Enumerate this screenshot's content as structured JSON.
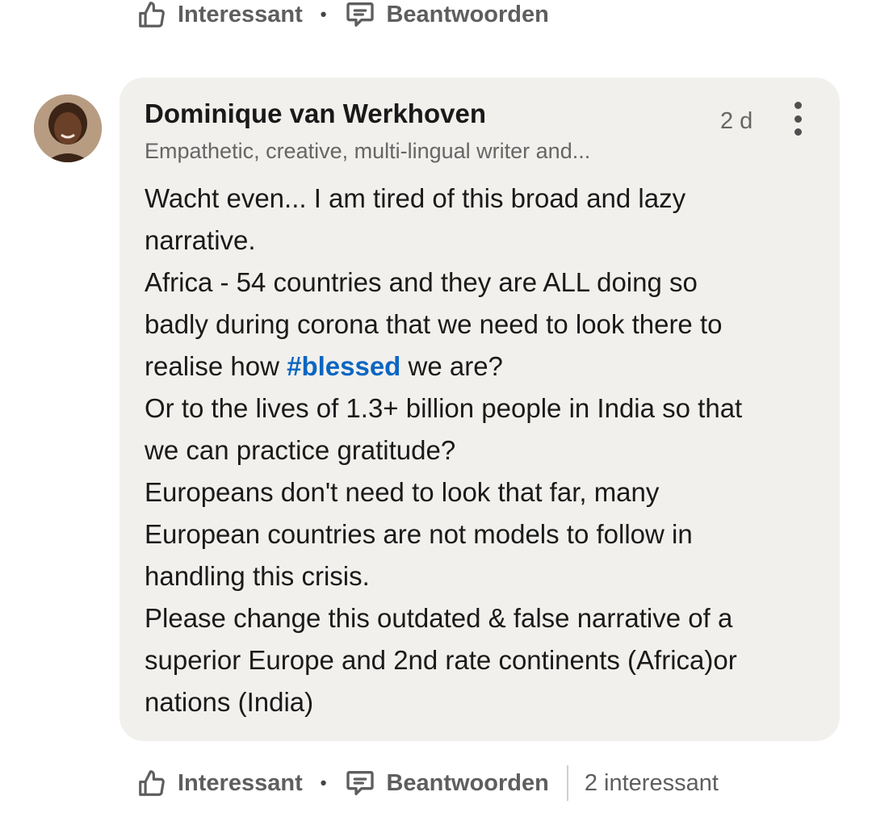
{
  "top_actions": {
    "like_label": "Interessant",
    "separator": "•",
    "reply_label": "Beantwoorden"
  },
  "comment": {
    "author": "Dominique van Werkhoven",
    "headline": "Empathetic, creative, multi-lingual writer and...",
    "time": "2 d",
    "body_lines": [
      {
        "before": "Wacht even... I am tired of this broad and lazy",
        "hashtag": "",
        "after": ""
      },
      {
        "before": "narrative.",
        "hashtag": "",
        "after": ""
      },
      {
        "before": "Africa - 54 countries and they are ALL doing so",
        "hashtag": "",
        "after": ""
      },
      {
        "before": "badly during corona that we need to look there to",
        "hashtag": "",
        "after": ""
      },
      {
        "before": "realise how ",
        "hashtag": "#blessed",
        "after": " we are?"
      },
      {
        "before": "Or to the lives of 1.3+ billion people in India so that",
        "hashtag": "",
        "after": ""
      },
      {
        "before": "we can practice gratitude?",
        "hashtag": "",
        "after": ""
      },
      {
        "before": "Europeans don't need to look that far, many",
        "hashtag": "",
        "after": ""
      },
      {
        "before": "European countries are not models to follow in",
        "hashtag": "",
        "after": ""
      },
      {
        "before": "handling this crisis.",
        "hashtag": "",
        "after": ""
      },
      {
        "before": "Please change this outdated & false narrative of a",
        "hashtag": "",
        "after": ""
      },
      {
        "before": "superior Europe and 2nd rate continents (Africa)or",
        "hashtag": "",
        "after": ""
      },
      {
        "before": "nations (India)",
        "hashtag": "",
        "after": ""
      }
    ]
  },
  "bottom_actions": {
    "like_label": "Interessant",
    "separator": "•",
    "reply_label": "Beantwoorden",
    "reaction_count": "2 interessant"
  },
  "icons": {
    "like": "thumbs-up-icon",
    "reply": "comment-bubble-icon",
    "more": "more-vertical-icon"
  },
  "colors": {
    "bubble_bg": "#f2f0ed",
    "hashtag": "#0a66c2",
    "meta_text": "#666666"
  }
}
